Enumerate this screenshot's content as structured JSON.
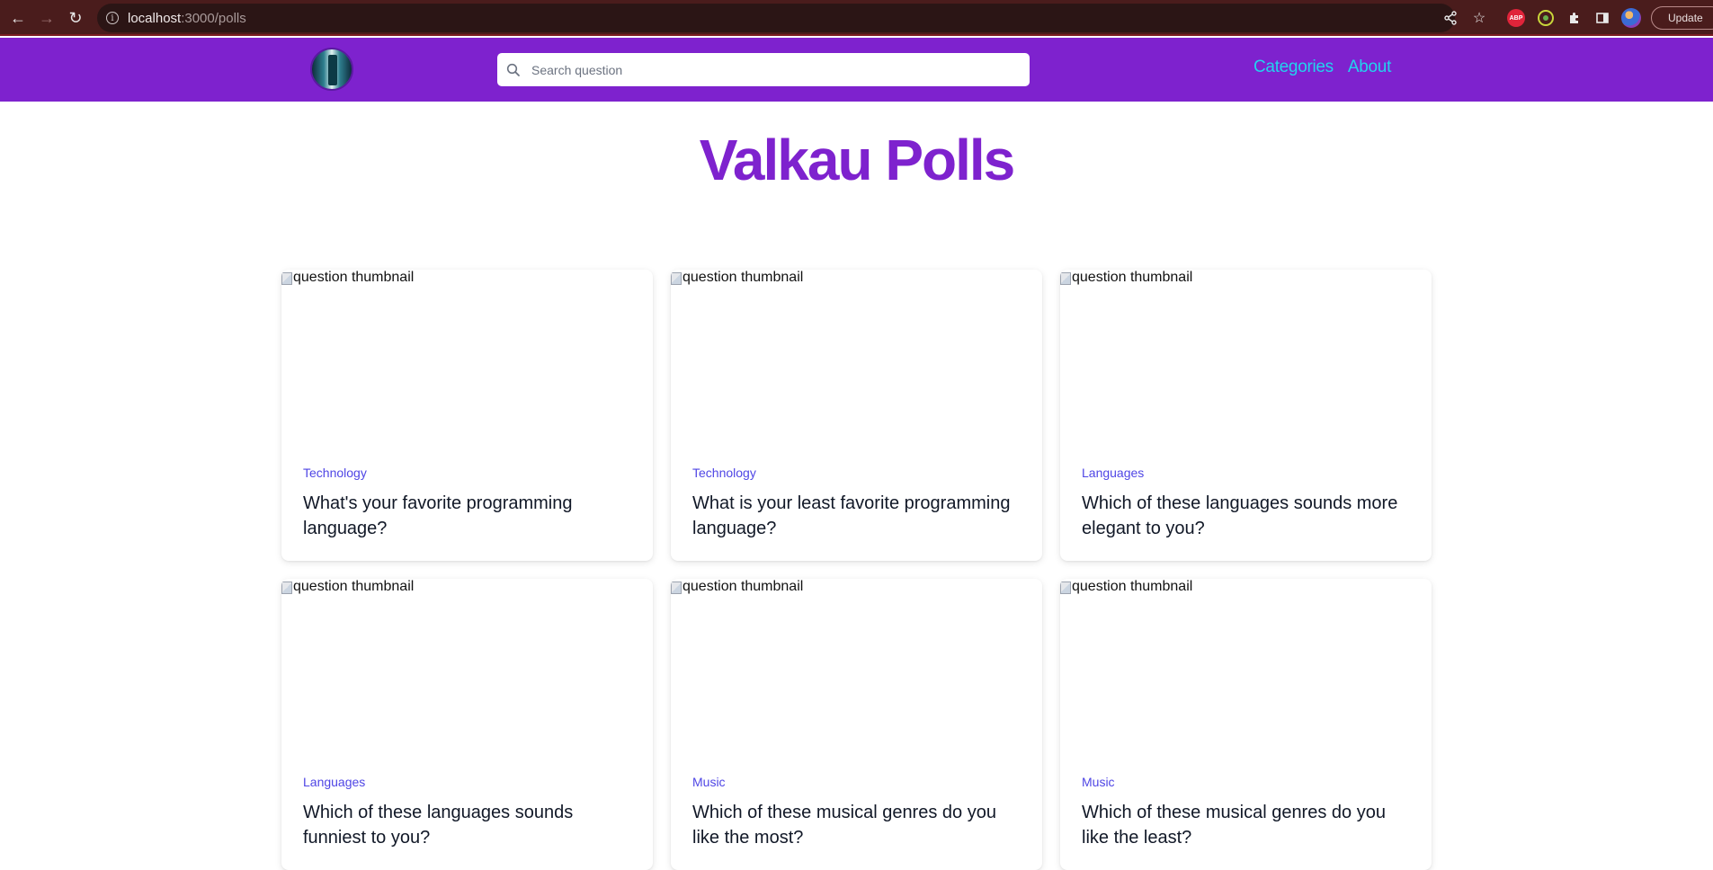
{
  "browser": {
    "url_host": "localhost",
    "url_path": ":3000/polls",
    "update_label": "Update",
    "abp_label": "ABP"
  },
  "header": {
    "search_placeholder": "Search question",
    "nav": [
      {
        "label": "Categories"
      },
      {
        "label": "About"
      }
    ]
  },
  "main": {
    "title": "Valkau Polls",
    "thumbnail_alt": "question thumbnail",
    "polls": [
      {
        "category": "Technology",
        "question": "What's your favorite programming language?"
      },
      {
        "category": "Technology",
        "question": "What is your least favorite programming language?"
      },
      {
        "category": "Languages",
        "question": "Which of these languages sounds more elegant to you?"
      },
      {
        "category": "Languages",
        "question": "Which of these languages sounds funniest to you?"
      },
      {
        "category": "Music",
        "question": "Which of these musical genres do you like the most?"
      },
      {
        "category": "Music",
        "question": "Which of these musical genres do you like the least?"
      }
    ]
  },
  "colors": {
    "header_bg": "#7e22ce",
    "title": "#7e22ce",
    "nav_link": "#22d3ee",
    "category": "#4f46e5",
    "browser_bar": "#4a1c1c"
  }
}
